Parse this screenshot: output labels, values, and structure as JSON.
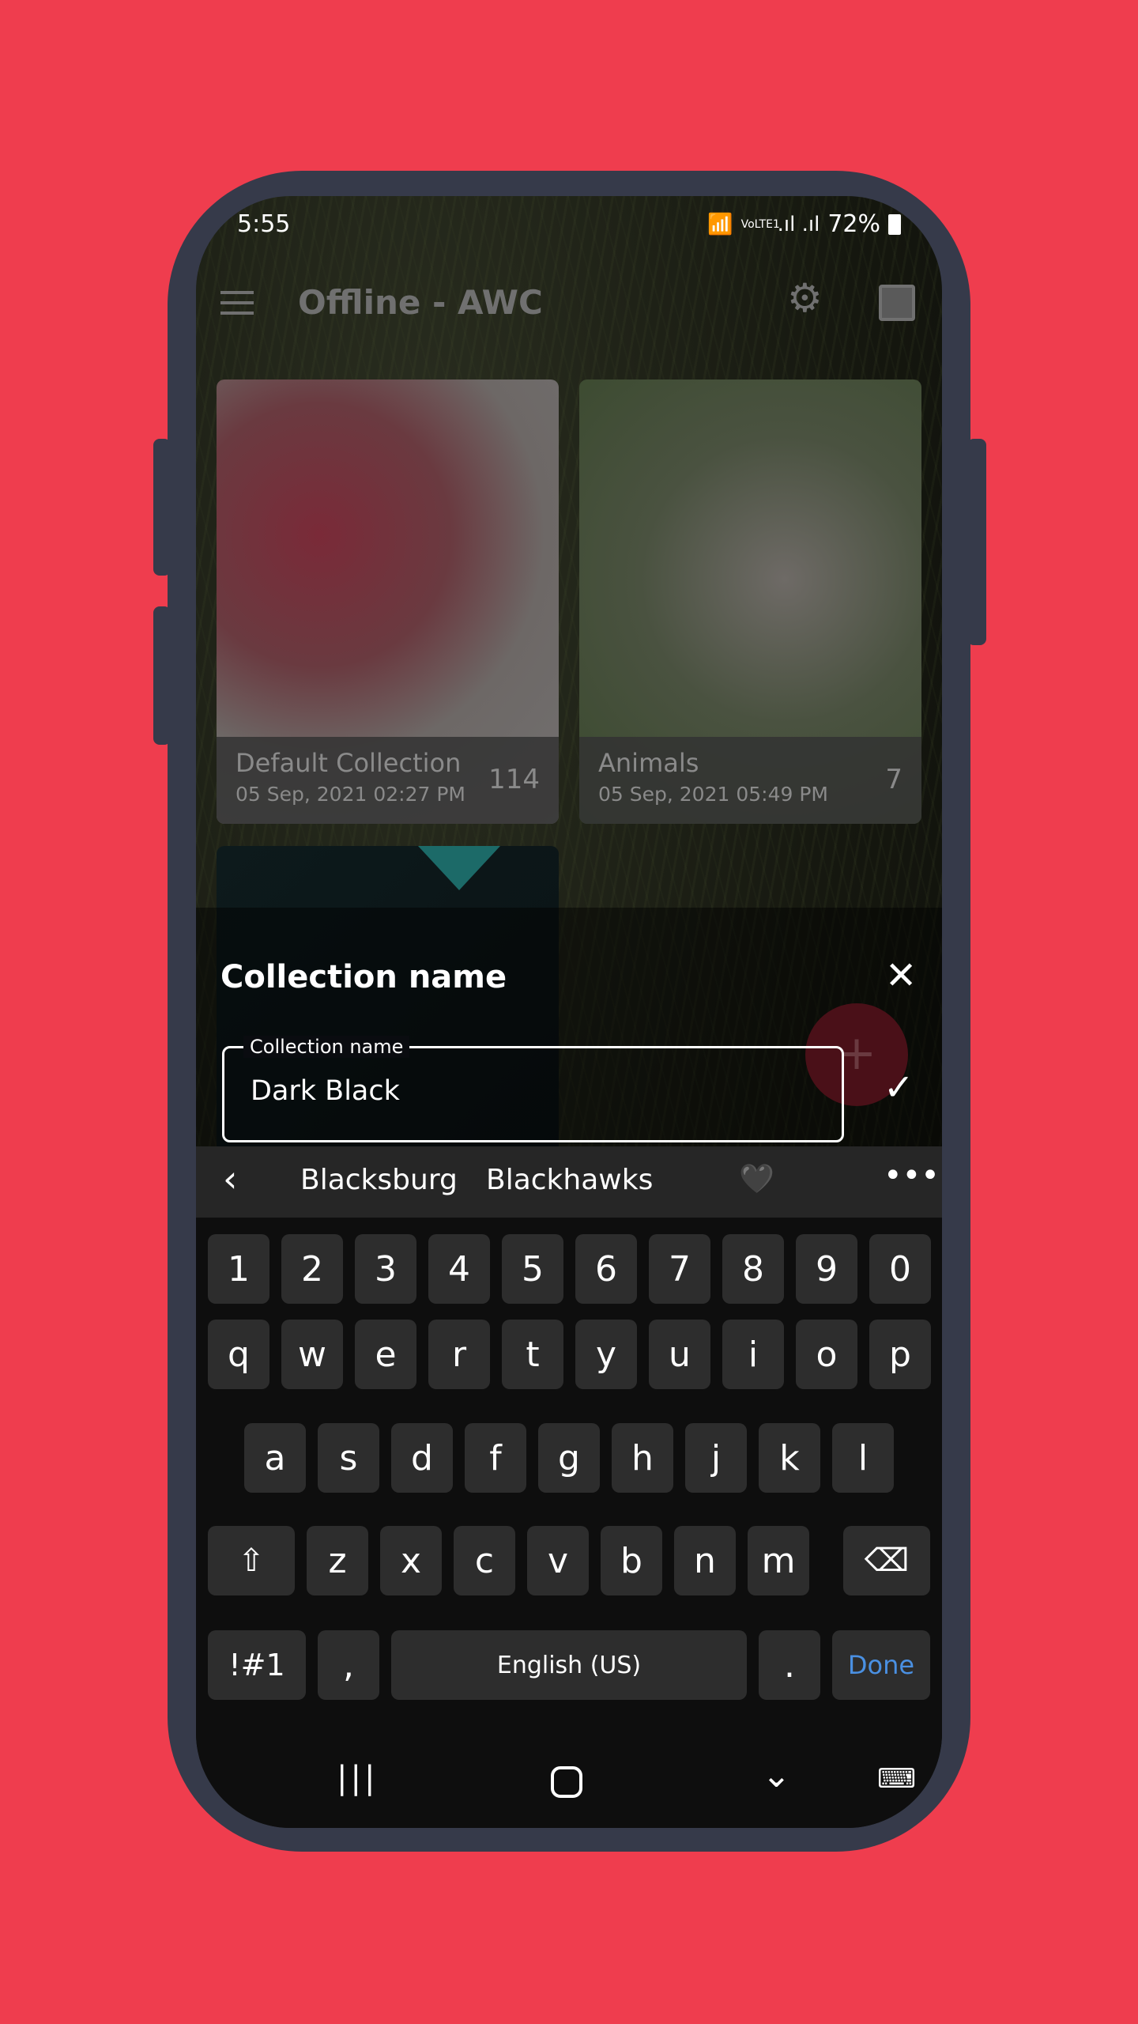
{
  "status_bar": {
    "time": "5:55",
    "network": "VoLTE1",
    "battery": "72%"
  },
  "app_bar": {
    "title": "Offline - AWC",
    "menu_icon": "hamburger-menu-icon",
    "settings_icon": "gear-icon",
    "gallery_icon": "photo-library-icon"
  },
  "collections": [
    {
      "name": "Default Collection",
      "date": "05 Sep, 2021 02:27 PM",
      "count": "114"
    },
    {
      "name": "Animals",
      "date": "05 Sep, 2021 05:49 PM",
      "count": "7"
    }
  ],
  "dialog": {
    "title": "Collection name",
    "field_label": "Collection name",
    "field_value": "Dark Black",
    "close_icon": "close-icon",
    "confirm_icon": "check-icon"
  },
  "fab": {
    "icon": "plus-icon",
    "color": "#e23b4b"
  },
  "keyboard": {
    "suggestions": [
      "Blacksburg",
      "Blackhawks"
    ],
    "emoji_suggestion": "🖤",
    "rows": [
      [
        "1",
        "2",
        "3",
        "4",
        "5",
        "6",
        "7",
        "8",
        "9",
        "0"
      ],
      [
        "q",
        "w",
        "e",
        "r",
        "t",
        "y",
        "u",
        "i",
        "o",
        "p"
      ],
      [
        "a",
        "s",
        "d",
        "f",
        "g",
        "h",
        "j",
        "k",
        "l"
      ],
      [
        "z",
        "x",
        "c",
        "v",
        "b",
        "n",
        "m"
      ]
    ],
    "symbols_label": "!#1",
    "comma": ",",
    "space_label": "English (US)",
    "period": ".",
    "done_label": "Done",
    "done_color": "#4a90e2"
  },
  "colors": {
    "background": "#ef3d4e",
    "frame": "#363a4a"
  }
}
